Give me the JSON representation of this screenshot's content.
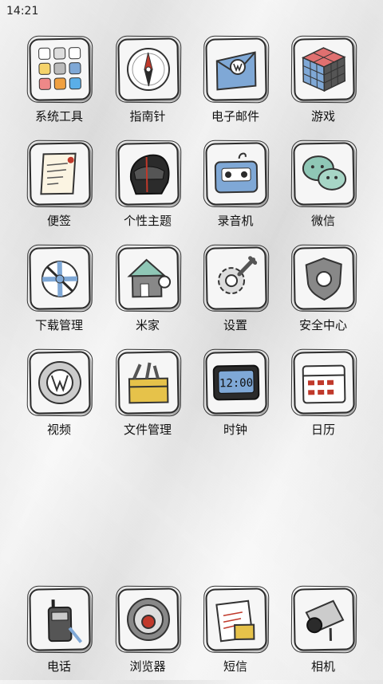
{
  "status_bar": {
    "time": "14:21"
  },
  "apps": [
    {
      "label": "系统工具",
      "icon": "system-tools-icon"
    },
    {
      "label": "指南针",
      "icon": "compass-icon"
    },
    {
      "label": "电子邮件",
      "icon": "email-icon"
    },
    {
      "label": "游戏",
      "icon": "rubiks-cube-icon"
    },
    {
      "label": "便签",
      "icon": "notes-icon"
    },
    {
      "label": "个性主题",
      "icon": "helmet-icon"
    },
    {
      "label": "录音机",
      "icon": "cassette-icon"
    },
    {
      "label": "微信",
      "icon": "wechat-icon"
    },
    {
      "label": "下载管理",
      "icon": "download-icon"
    },
    {
      "label": "米家",
      "icon": "house-icon"
    },
    {
      "label": "设置",
      "icon": "gear-wrench-icon"
    },
    {
      "label": "安全中心",
      "icon": "shield-icon"
    },
    {
      "label": "视频",
      "icon": "vw-logo-icon"
    },
    {
      "label": "文件管理",
      "icon": "toolbox-icon"
    },
    {
      "label": "时钟",
      "icon": "digital-clock-icon"
    },
    {
      "label": "日历",
      "icon": "calendar-icon"
    }
  ],
  "dock": [
    {
      "label": "电话",
      "icon": "walkie-talkie-icon"
    },
    {
      "label": "浏览器",
      "icon": "steering-wheel-icon"
    },
    {
      "label": "短信",
      "icon": "letter-icon"
    },
    {
      "label": "相机",
      "icon": "camera-icon"
    }
  ],
  "clock_display": "12:00",
  "colors": {
    "blue": "#7fa8d6",
    "dark": "#2b2b2b",
    "red": "#c0392b",
    "yellow": "#e6c24a"
  }
}
